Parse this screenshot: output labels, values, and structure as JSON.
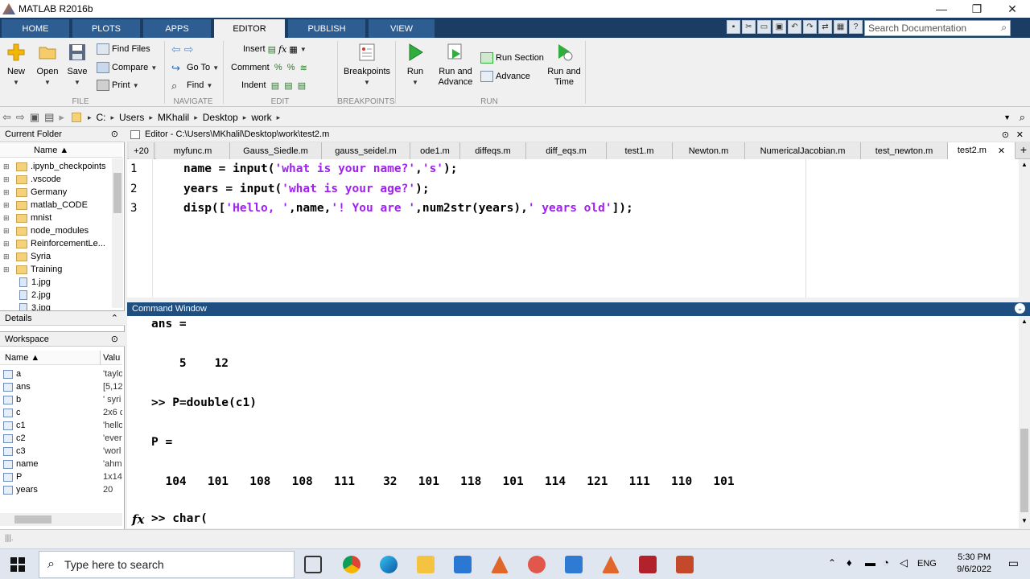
{
  "window": {
    "title": "MATLAB R2016b",
    "min": "—",
    "max": "❐",
    "close": "✕"
  },
  "ribbon_tabs": [
    "HOME",
    "PLOTS",
    "APPS",
    "EDITOR",
    "PUBLISH",
    "VIEW"
  ],
  "search_placeholder": "Search Documentation",
  "ribbon": {
    "file": {
      "new": "New",
      "open": "Open",
      "save": "Save",
      "find_files": "Find Files",
      "compare": "Compare",
      "print": "Print",
      "label": "FILE"
    },
    "navigate": {
      "go_to": "Go To",
      "find": "Find",
      "label": "NAVIGATE"
    },
    "edit": {
      "insert": "Insert",
      "comment": "Comment",
      "indent": "Indent",
      "label": "EDIT"
    },
    "breakpoints": {
      "breakpoints": "Breakpoints",
      "label": "BREAKPOINTS"
    },
    "run": {
      "run": "Run",
      "run_and_advance_1": "Run and",
      "run_and_advance_2": "Advance",
      "run_section": "Run Section",
      "advance": "Advance",
      "run_and_time_1": "Run and",
      "run_and_time_2": "Time",
      "label": "RUN"
    }
  },
  "path": [
    "C:",
    "Users",
    "MKhalil",
    "Desktop",
    "work"
  ],
  "current_folder": {
    "title": "Current Folder",
    "col_name": "Name ▲",
    "items": [
      {
        "name": ".ipynb_checkpoints",
        "type": "folder"
      },
      {
        "name": ".vscode",
        "type": "folder"
      },
      {
        "name": "Germany",
        "type": "folder"
      },
      {
        "name": "matlab_CODE",
        "type": "folder"
      },
      {
        "name": "mnist",
        "type": "folder"
      },
      {
        "name": "node_modules",
        "type": "folder"
      },
      {
        "name": "ReinforcementLe...",
        "type": "folder"
      },
      {
        "name": "Syria",
        "type": "folder"
      },
      {
        "name": "Training",
        "type": "folder"
      },
      {
        "name": "1.jpg",
        "type": "file"
      },
      {
        "name": "2.jpg",
        "type": "file"
      },
      {
        "name": "3.jpg",
        "type": "file"
      }
    ]
  },
  "details": {
    "title": "Details"
  },
  "workspace": {
    "title": "Workspace",
    "col_name": "Name ▲",
    "col_value": "Valu",
    "vars": [
      {
        "name": "a",
        "value": "'taylo"
      },
      {
        "name": "ans",
        "value": "[5,12"
      },
      {
        "name": "b",
        "value": "' syri"
      },
      {
        "name": "c",
        "value": "2x6 c"
      },
      {
        "name": "c1",
        "value": "'hello"
      },
      {
        "name": "c2",
        "value": "'ever"
      },
      {
        "name": "c3",
        "value": "'worl"
      },
      {
        "name": "name",
        "value": "'ahm"
      },
      {
        "name": "P",
        "value": "1x14"
      },
      {
        "name": "years",
        "value": "20"
      }
    ]
  },
  "editor": {
    "header": "Editor - C:\\Users\\MKhalil\\Desktop\\work\\test2.m",
    "tab_count": "+20",
    "tabs": [
      "myfunc.m",
      "Gauss_Siedle.m",
      "gauss_seidel.m",
      "ode1.m",
      "diffeqs.m",
      "diff_eqs.m",
      "test1.m",
      "Newton.m",
      "NumericalJacobian.m",
      "test_newton.m",
      "test2.m"
    ],
    "active_tab": "test2.m",
    "lines": [
      {
        "num": "1",
        "parts": [
          {
            "t": "name = input(",
            "s": false
          },
          {
            "t": "'what is your name?'",
            "s": true
          },
          {
            "t": ",",
            "s": false
          },
          {
            "t": "'s'",
            "s": true
          },
          {
            "t": ");",
            "s": false
          }
        ]
      },
      {
        "num": "2",
        "parts": [
          {
            "t": "years = input(",
            "s": false
          },
          {
            "t": "'what is your age?'",
            "s": true
          },
          {
            "t": ");",
            "s": false
          }
        ]
      },
      {
        "num": "3",
        "parts": [
          {
            "t": "disp([",
            "s": false
          },
          {
            "t": "'Hello, '",
            "s": true
          },
          {
            "t": ",name,",
            "s": false
          },
          {
            "t": "'! You are '",
            "s": true
          },
          {
            "t": ",num2str(years),",
            "s": false
          },
          {
            "t": "' years old'",
            "s": true
          },
          {
            "t": "]);",
            "s": false
          }
        ]
      }
    ]
  },
  "command_window": {
    "title": "Command Window",
    "lines": [
      "ans =",
      "",
      "    5    12",
      "",
      ">> P=double(c1)",
      "",
      "P =",
      "",
      "  104   101   108   108   111    32   101   118   101   114   121   111   110   101"
    ],
    "prompt": ">> ",
    "input": "char(",
    "fx": "fx"
  },
  "taskbar": {
    "search": "Type here to search",
    "time": "5:30 PM",
    "date": "9/6/2022",
    "lang": "ENG"
  }
}
